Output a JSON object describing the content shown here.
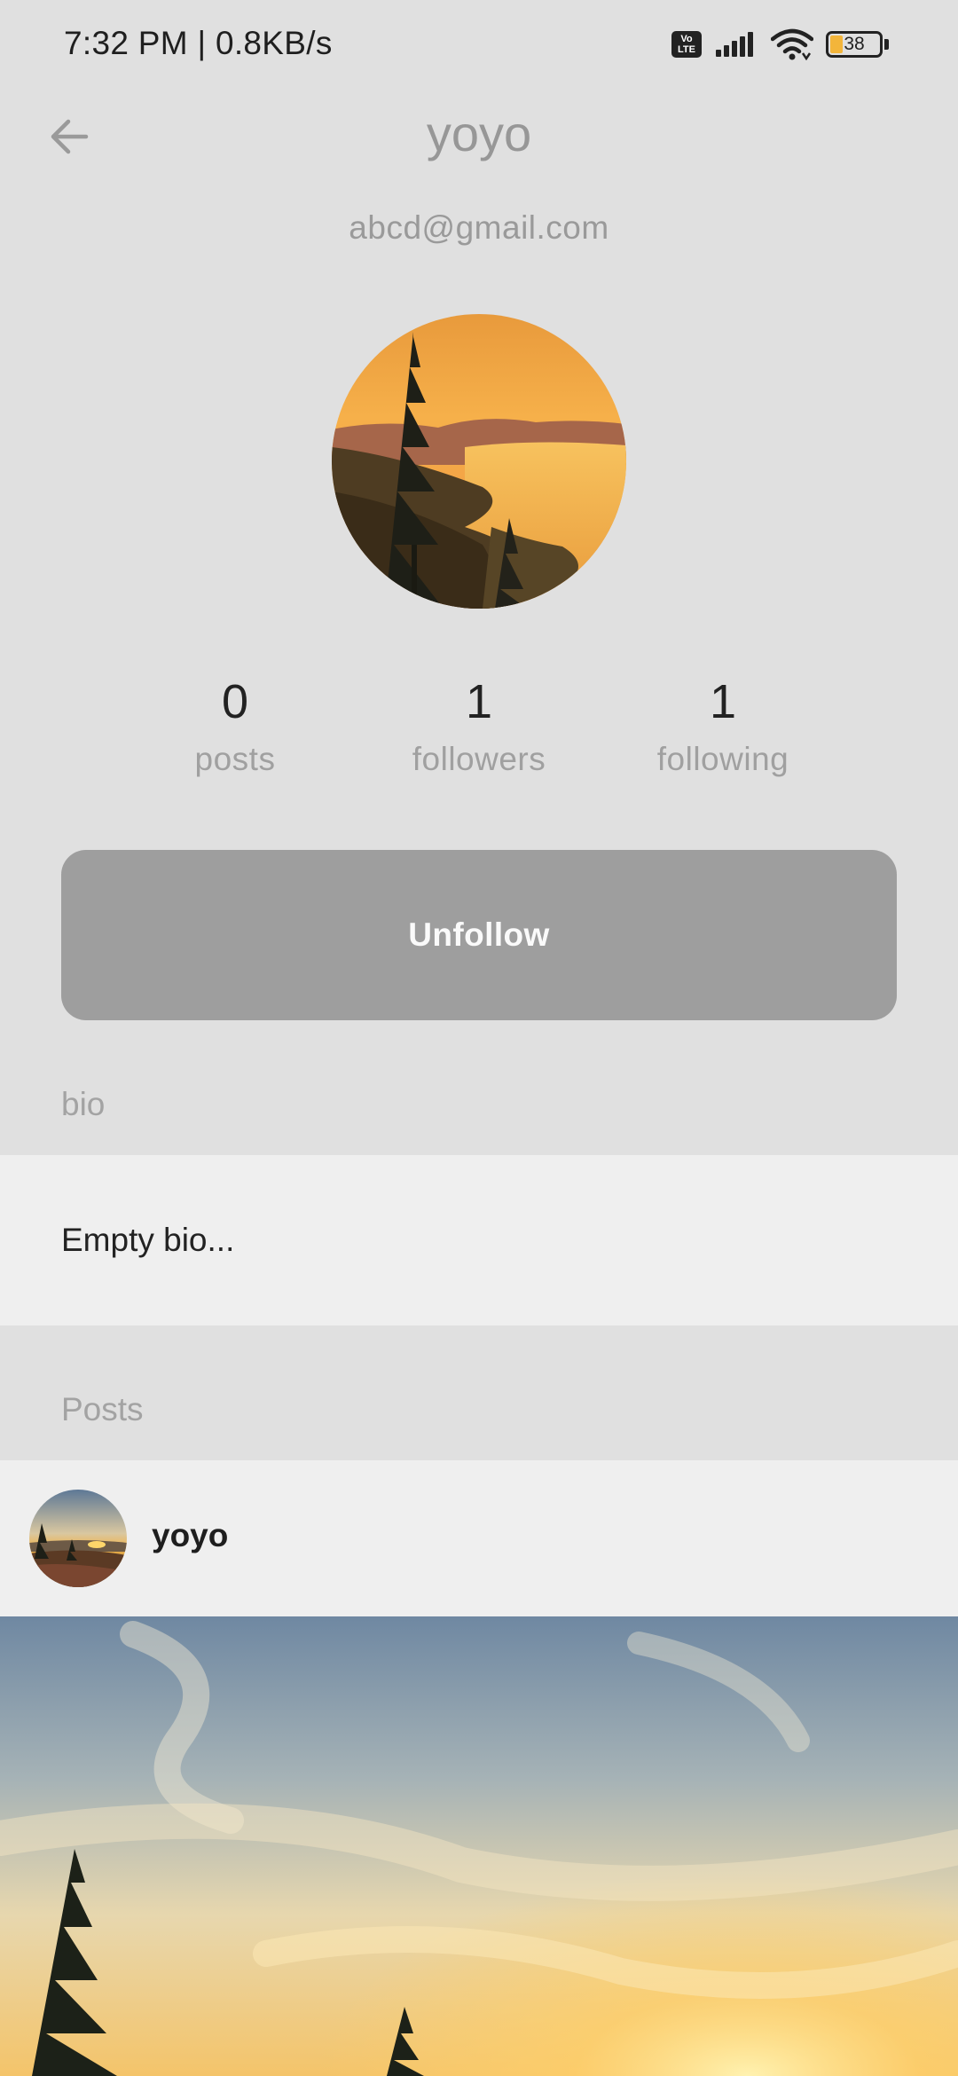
{
  "status_bar": {
    "time": "7:32 PM | 0.8KB/s",
    "volte": "Vo LTE",
    "battery": "38",
    "icons": [
      "volte-icon",
      "signal-icon",
      "wifi-icon",
      "battery-icon"
    ]
  },
  "header": {
    "back_icon": "arrow-left-icon",
    "title": "yoyo"
  },
  "profile": {
    "email": "abcd@gmail.com",
    "avatar": "pine-tree-sunset-lake-image",
    "stats": [
      {
        "value": "0",
        "label": "posts"
      },
      {
        "value": "1",
        "label": "followers"
      },
      {
        "value": "1",
        "label": "following"
      }
    ],
    "unfollow_label": "Unfollow"
  },
  "bio": {
    "label": "bio",
    "text": "Empty bio..."
  },
  "posts": {
    "label": "Posts",
    "items": [
      {
        "username": "yoyo",
        "avatar": "sunset-meadow-image",
        "image": "sunset-sky-pine-trees-image"
      }
    ]
  },
  "colors": {
    "background": "#e0e0e0",
    "card": "#efefef",
    "button": "#9e9e9e",
    "muted_text": "#a0a0a0"
  }
}
